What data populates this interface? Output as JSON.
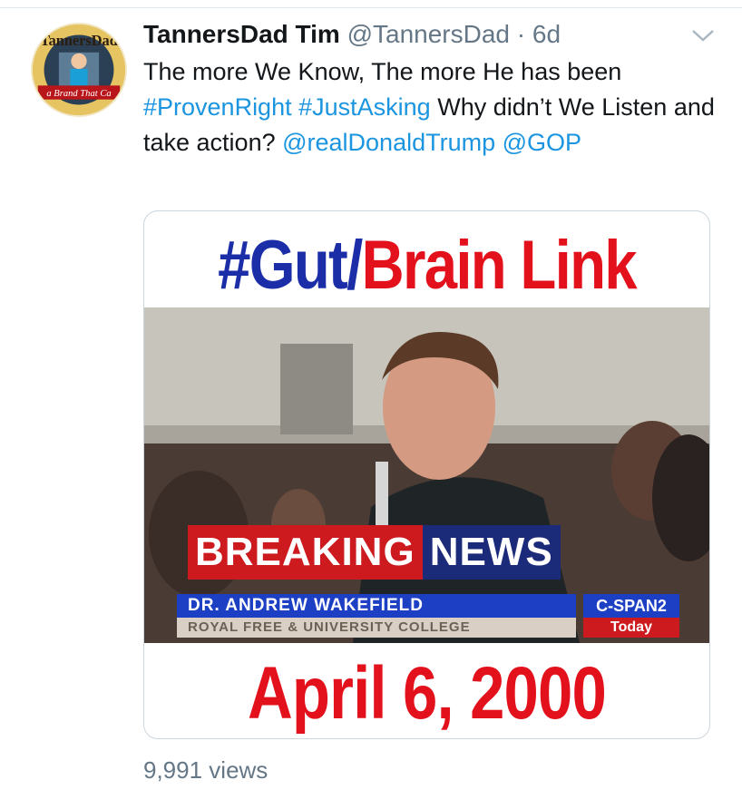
{
  "tweet": {
    "display_name": "TannersDad Tim",
    "handle": "@TannersDad",
    "separator": "·",
    "time": "6d",
    "text_part1": "The more We Know, The more He has been ",
    "hashtag1": "#ProvenRight",
    "space1": " ",
    "hashtag2": "#JustAsking",
    "text_part2": " Why didn’t We Listen and take action? ",
    "mention1": "@realDonaldTrump",
    "space2": " ",
    "mention2": "@GOP",
    "views": "9,991 views"
  },
  "avatar": {
    "top_text": "TannersDad",
    "bottom_text": "a Brand That Ca"
  },
  "media": {
    "headline_hash": "#Gut/",
    "headline_rest": "Brain Link",
    "breaking_left": "BREAKING",
    "breaking_right": "NEWS",
    "lower_name": "DR. ANDREW WAKEFIELD",
    "lower_sub": "ROYAL FREE & UNIVERSITY COLLEGE",
    "network": "C-SPAN2",
    "network_sub": "Today",
    "date": "April 6, 2000"
  },
  "icons": {
    "more": "chevron-down-icon"
  },
  "colors": {
    "link": "#1b95e0",
    "headline_blue": "#1b2ea8",
    "headline_red": "#e3111b"
  }
}
